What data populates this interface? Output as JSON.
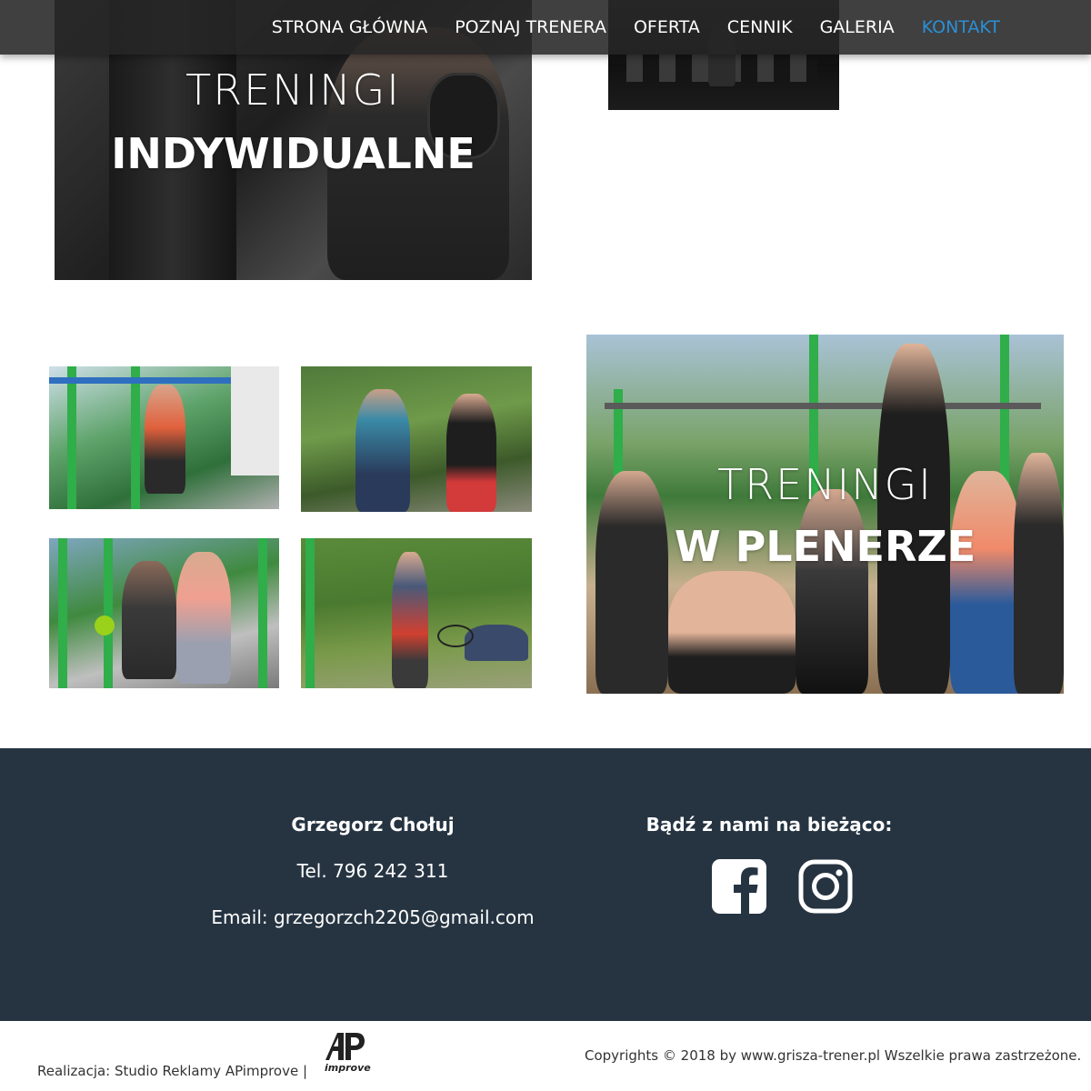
{
  "nav": {
    "items": [
      {
        "label": "STRONA GŁÓWNA",
        "active": false
      },
      {
        "label": "POZNAJ TRENERA",
        "active": false
      },
      {
        "label": "OFERTA",
        "active": false
      },
      {
        "label": "CENNIK",
        "active": false
      },
      {
        "label": "GALERIA",
        "active": false
      },
      {
        "label": "KONTAKT",
        "active": true
      }
    ],
    "active_color": "#2a8fd6"
  },
  "sections": {
    "individual": {
      "title_light": "TRENINGI",
      "title_bold": "INDYWIDUALNE"
    },
    "outdoor": {
      "title_light": "TRENINGI",
      "title_bold": "W PLENERZE"
    }
  },
  "footer": {
    "background": "#263442",
    "contact": {
      "name": "Grzegorz Chołuj",
      "phone": "Tel. 796 242 311",
      "email": "Email: grzegorzch2205@gmail.com"
    },
    "social": {
      "heading": "Bądź z nami na bieżąco:",
      "icons": [
        "facebook-icon",
        "instagram-icon"
      ]
    },
    "credit": "Realizacja: Studio Reklamy APimprove |",
    "logo_text": "improve",
    "copyright": "Copyrights © 2018 by www.grisza-trener.pl Wszelkie prawa zastrzeżone."
  }
}
